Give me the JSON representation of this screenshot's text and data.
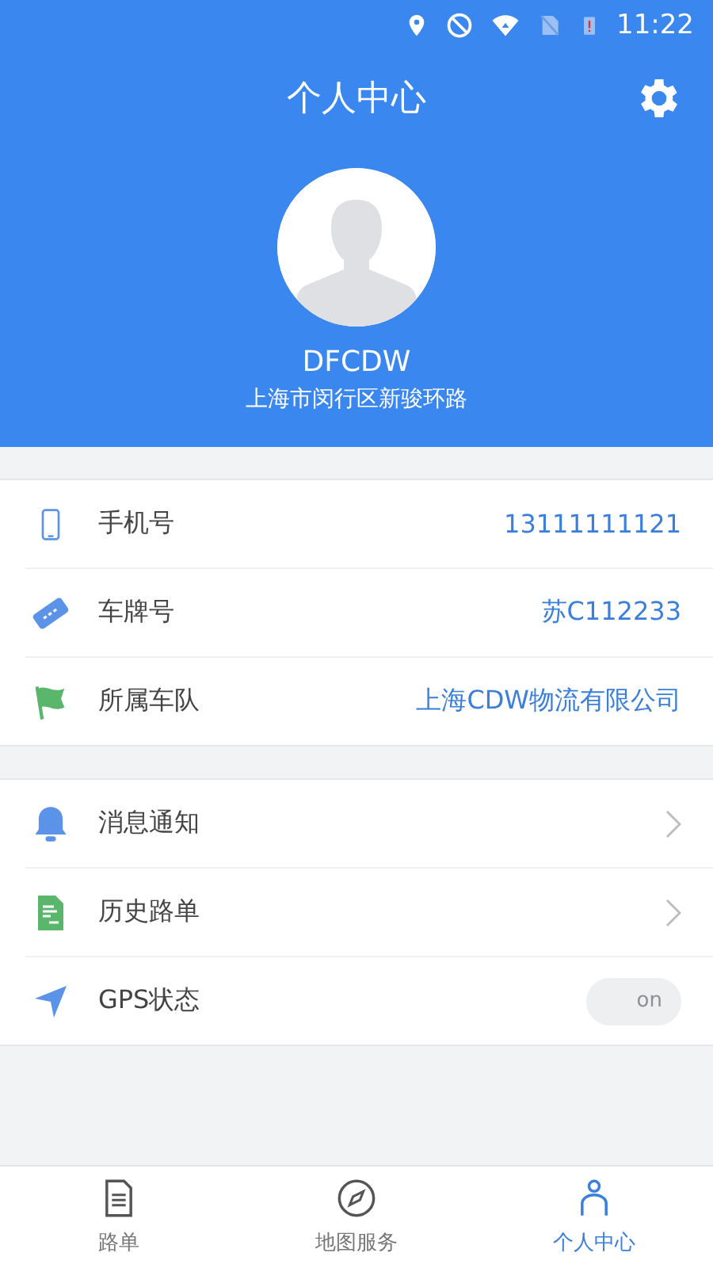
{
  "status_bar": {
    "time": "11:22"
  },
  "header": {
    "title": "个人中心"
  },
  "profile": {
    "name": "DFCDW",
    "address": "上海市闵行区新骏环路"
  },
  "info_rows": [
    {
      "label": "手机号",
      "value": "13111111121"
    },
    {
      "label": "车牌号",
      "value": "苏C112233"
    },
    {
      "label": "所属车队",
      "value": "上海CDW物流有限公司"
    }
  ],
  "settings_rows": [
    {
      "kind": "link",
      "label": "消息通知"
    },
    {
      "kind": "link",
      "label": "历史路单"
    },
    {
      "kind": "toggle",
      "label": "GPS状态",
      "on": false,
      "toggle_label": "on"
    }
  ],
  "tabs": [
    {
      "label": "路单",
      "selected": false
    },
    {
      "label": "地图服务",
      "selected": false
    },
    {
      "label": "个人中心",
      "selected": true
    }
  ]
}
